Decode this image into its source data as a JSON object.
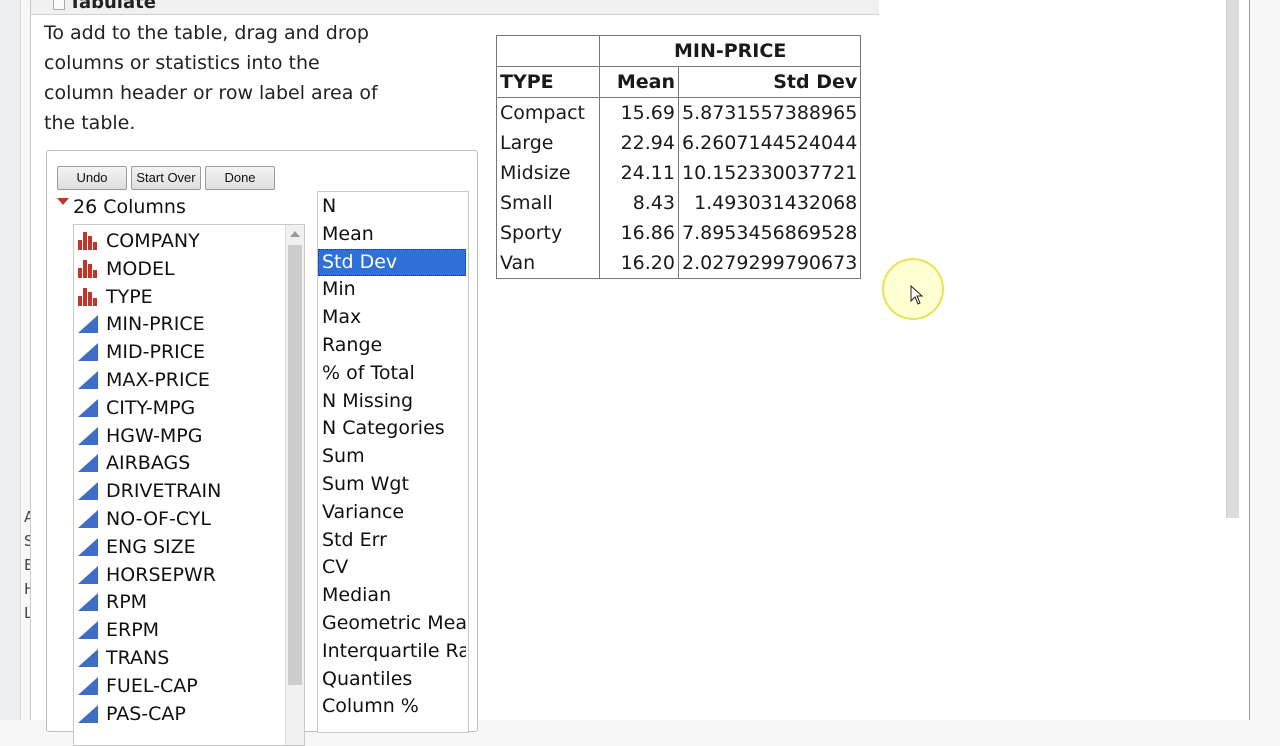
{
  "window": {
    "title": "Tabulate"
  },
  "instructions": "To add to the table, drag and drop columns or statistics into the column header or row label area of the table.",
  "buttons": {
    "undo": "Undo",
    "start_over": "Start Over",
    "done": "Done"
  },
  "columns_header": "26 Columns",
  "columns": [
    {
      "name": "COMPANY",
      "type": "nominal"
    },
    {
      "name": "MODEL",
      "type": "nominal"
    },
    {
      "name": "TYPE",
      "type": "nominal"
    },
    {
      "name": "MIN-PRICE",
      "type": "continuous"
    },
    {
      "name": "MID-PRICE",
      "type": "continuous"
    },
    {
      "name": "MAX-PRICE",
      "type": "continuous"
    },
    {
      "name": "CITY-MPG",
      "type": "continuous"
    },
    {
      "name": "HGW-MPG",
      "type": "continuous"
    },
    {
      "name": "AIRBAGS",
      "type": "continuous"
    },
    {
      "name": "DRIVETRAIN",
      "type": "continuous"
    },
    {
      "name": "NO-OF-CYL",
      "type": "continuous"
    },
    {
      "name": "ENG SIZE",
      "type": "continuous"
    },
    {
      "name": "HORSEPWR",
      "type": "continuous"
    },
    {
      "name": "RPM",
      "type": "continuous"
    },
    {
      "name": "ERPM",
      "type": "continuous"
    },
    {
      "name": "TRANS",
      "type": "continuous"
    },
    {
      "name": "FUEL-CAP",
      "type": "continuous"
    },
    {
      "name": "PAS-CAP",
      "type": "continuous"
    }
  ],
  "statistics": [
    "N",
    "Mean",
    "Std Dev",
    "Min",
    "Max",
    "Range",
    "% of Total",
    "N Missing",
    "N Categories",
    "Sum",
    "Sum Wgt",
    "Variance",
    "Std Err",
    "CV",
    "Median",
    "Geometric Mean",
    "Interquartile Range",
    "Quantiles",
    "Column %"
  ],
  "selected_statistic": "Std Dev",
  "table": {
    "group_header": "MIN-PRICE",
    "row_header": "TYPE",
    "col_headers": [
      "Mean",
      "Std Dev"
    ],
    "rows": [
      {
        "type": "Compact",
        "mean": "15.69",
        "std": "5.8731557388965"
      },
      {
        "type": "Large",
        "mean": "22.94",
        "std": "6.2607144524044"
      },
      {
        "type": "Midsize",
        "mean": "24.11",
        "std": "10.152330037721"
      },
      {
        "type": "Small",
        "mean": "8.43",
        "std": "1.493031432068"
      },
      {
        "type": "Sporty",
        "mean": "16.86",
        "std": "7.8953456869528"
      },
      {
        "type": "Van",
        "mean": "16.20",
        "std": "2.0279299790673"
      }
    ]
  },
  "background_letters": [
    "A",
    "S",
    "E",
    "H",
    "L"
  ],
  "colors": {
    "nominal": "#c0362c",
    "continuous": "#3f6cc4",
    "selection": "#2f6fd8"
  },
  "icons": {
    "nominal": "bar-chart-icon",
    "continuous": "triangle-ramp-icon"
  }
}
